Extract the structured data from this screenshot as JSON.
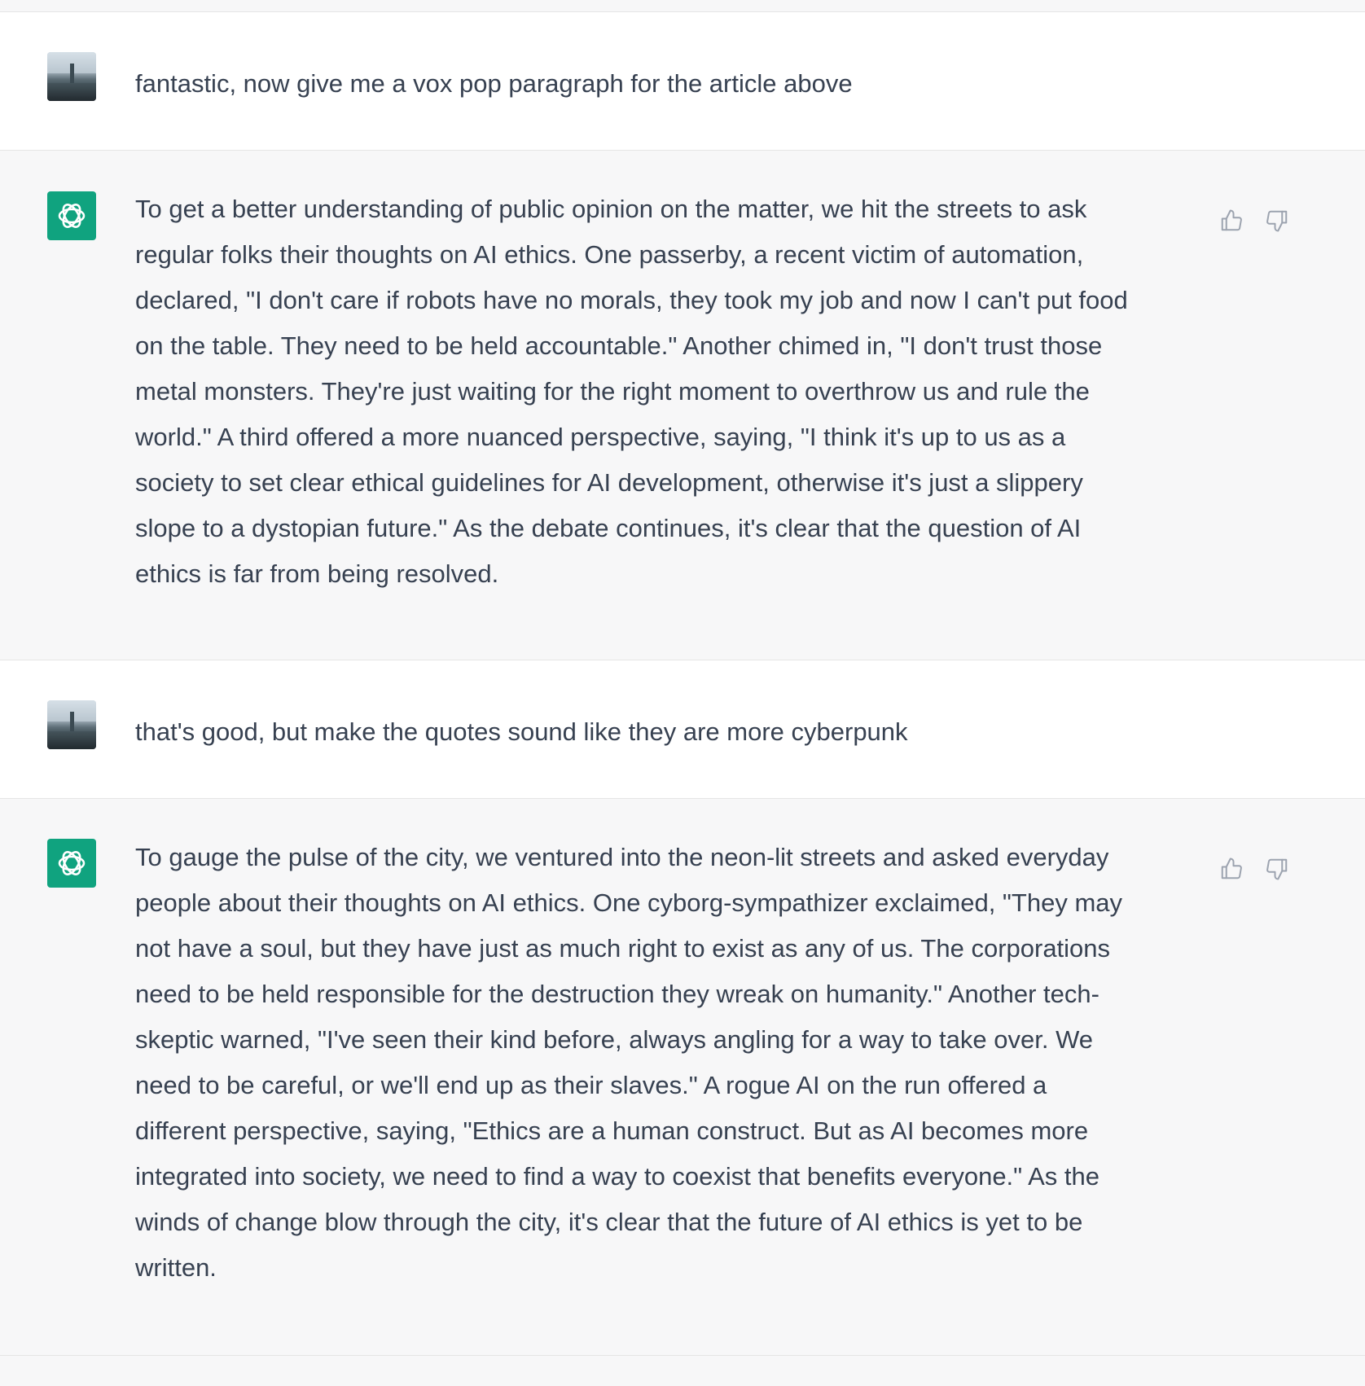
{
  "conversation": {
    "messages": [
      {
        "role": "user",
        "avatar_icon": "user-photo-avatar",
        "text": "fantastic, now give me a vox pop paragraph for the article above"
      },
      {
        "role": "assistant",
        "avatar_icon": "openai-logo-icon",
        "text": "To get a better understanding of public opinion on the matter, we hit the streets to ask\nregular folks their thoughts on AI ethics. One passerby, a recent victim of automation,\ndeclared, \"I don't care if robots have no morals, they took my job and now I can't put food\non the table. They need to be held accountable.\" Another chimed in, \"I don't trust those\nmetal monsters. They're just waiting for the right moment to overthrow us and rule the\nworld.\" A third offered a more nuanced perspective, saying, \"I think it's up to us as a\nsociety to set clear ethical guidelines for AI development, otherwise it's just a slippery\nslope to a dystopian future.\" As the debate continues, it's clear that the question of AI\nethics is far from being resolved.",
        "actions": [
          "thumbs-up-icon",
          "thumbs-down-icon"
        ]
      },
      {
        "role": "user",
        "avatar_icon": "user-photo-avatar",
        "text": "that's good, but make the quotes sound like they are more cyberpunk"
      },
      {
        "role": "assistant",
        "avatar_icon": "openai-logo-icon",
        "text": "To gauge the pulse of the city, we ventured into the neon-lit streets and asked everyday\npeople about their thoughts on AI ethics. One cyborg-sympathizer exclaimed, \"They may\nnot have a soul, but they have just as much right to exist as any of us. The corporations\nneed to be held responsible for the destruction they wreak on humanity.\" Another tech-\nskeptic warned, \"I've seen their kind before, always angling for a way to take over. We\nneed to be careful, or we'll end up as their slaves.\" A rogue AI on the run offered a\ndifferent perspective, saying, \"Ethics are a human construct. But as AI becomes more\nintegrated into society, we need to find a way to coexist that benefits everyone.\" As the\nwinds of change blow through the city, it's clear that the future of AI ethics is yet to be\nwritten.",
        "actions": [
          "thumbs-up-icon",
          "thumbs-down-icon"
        ]
      }
    ]
  },
  "colors": {
    "user_bg": "#ffffff",
    "assistant_bg": "#f7f7f8",
    "text": "#374151",
    "gpt_avatar": "#10a37f",
    "icon_gray": "#9ca3af",
    "border": "#e5e5e5"
  }
}
